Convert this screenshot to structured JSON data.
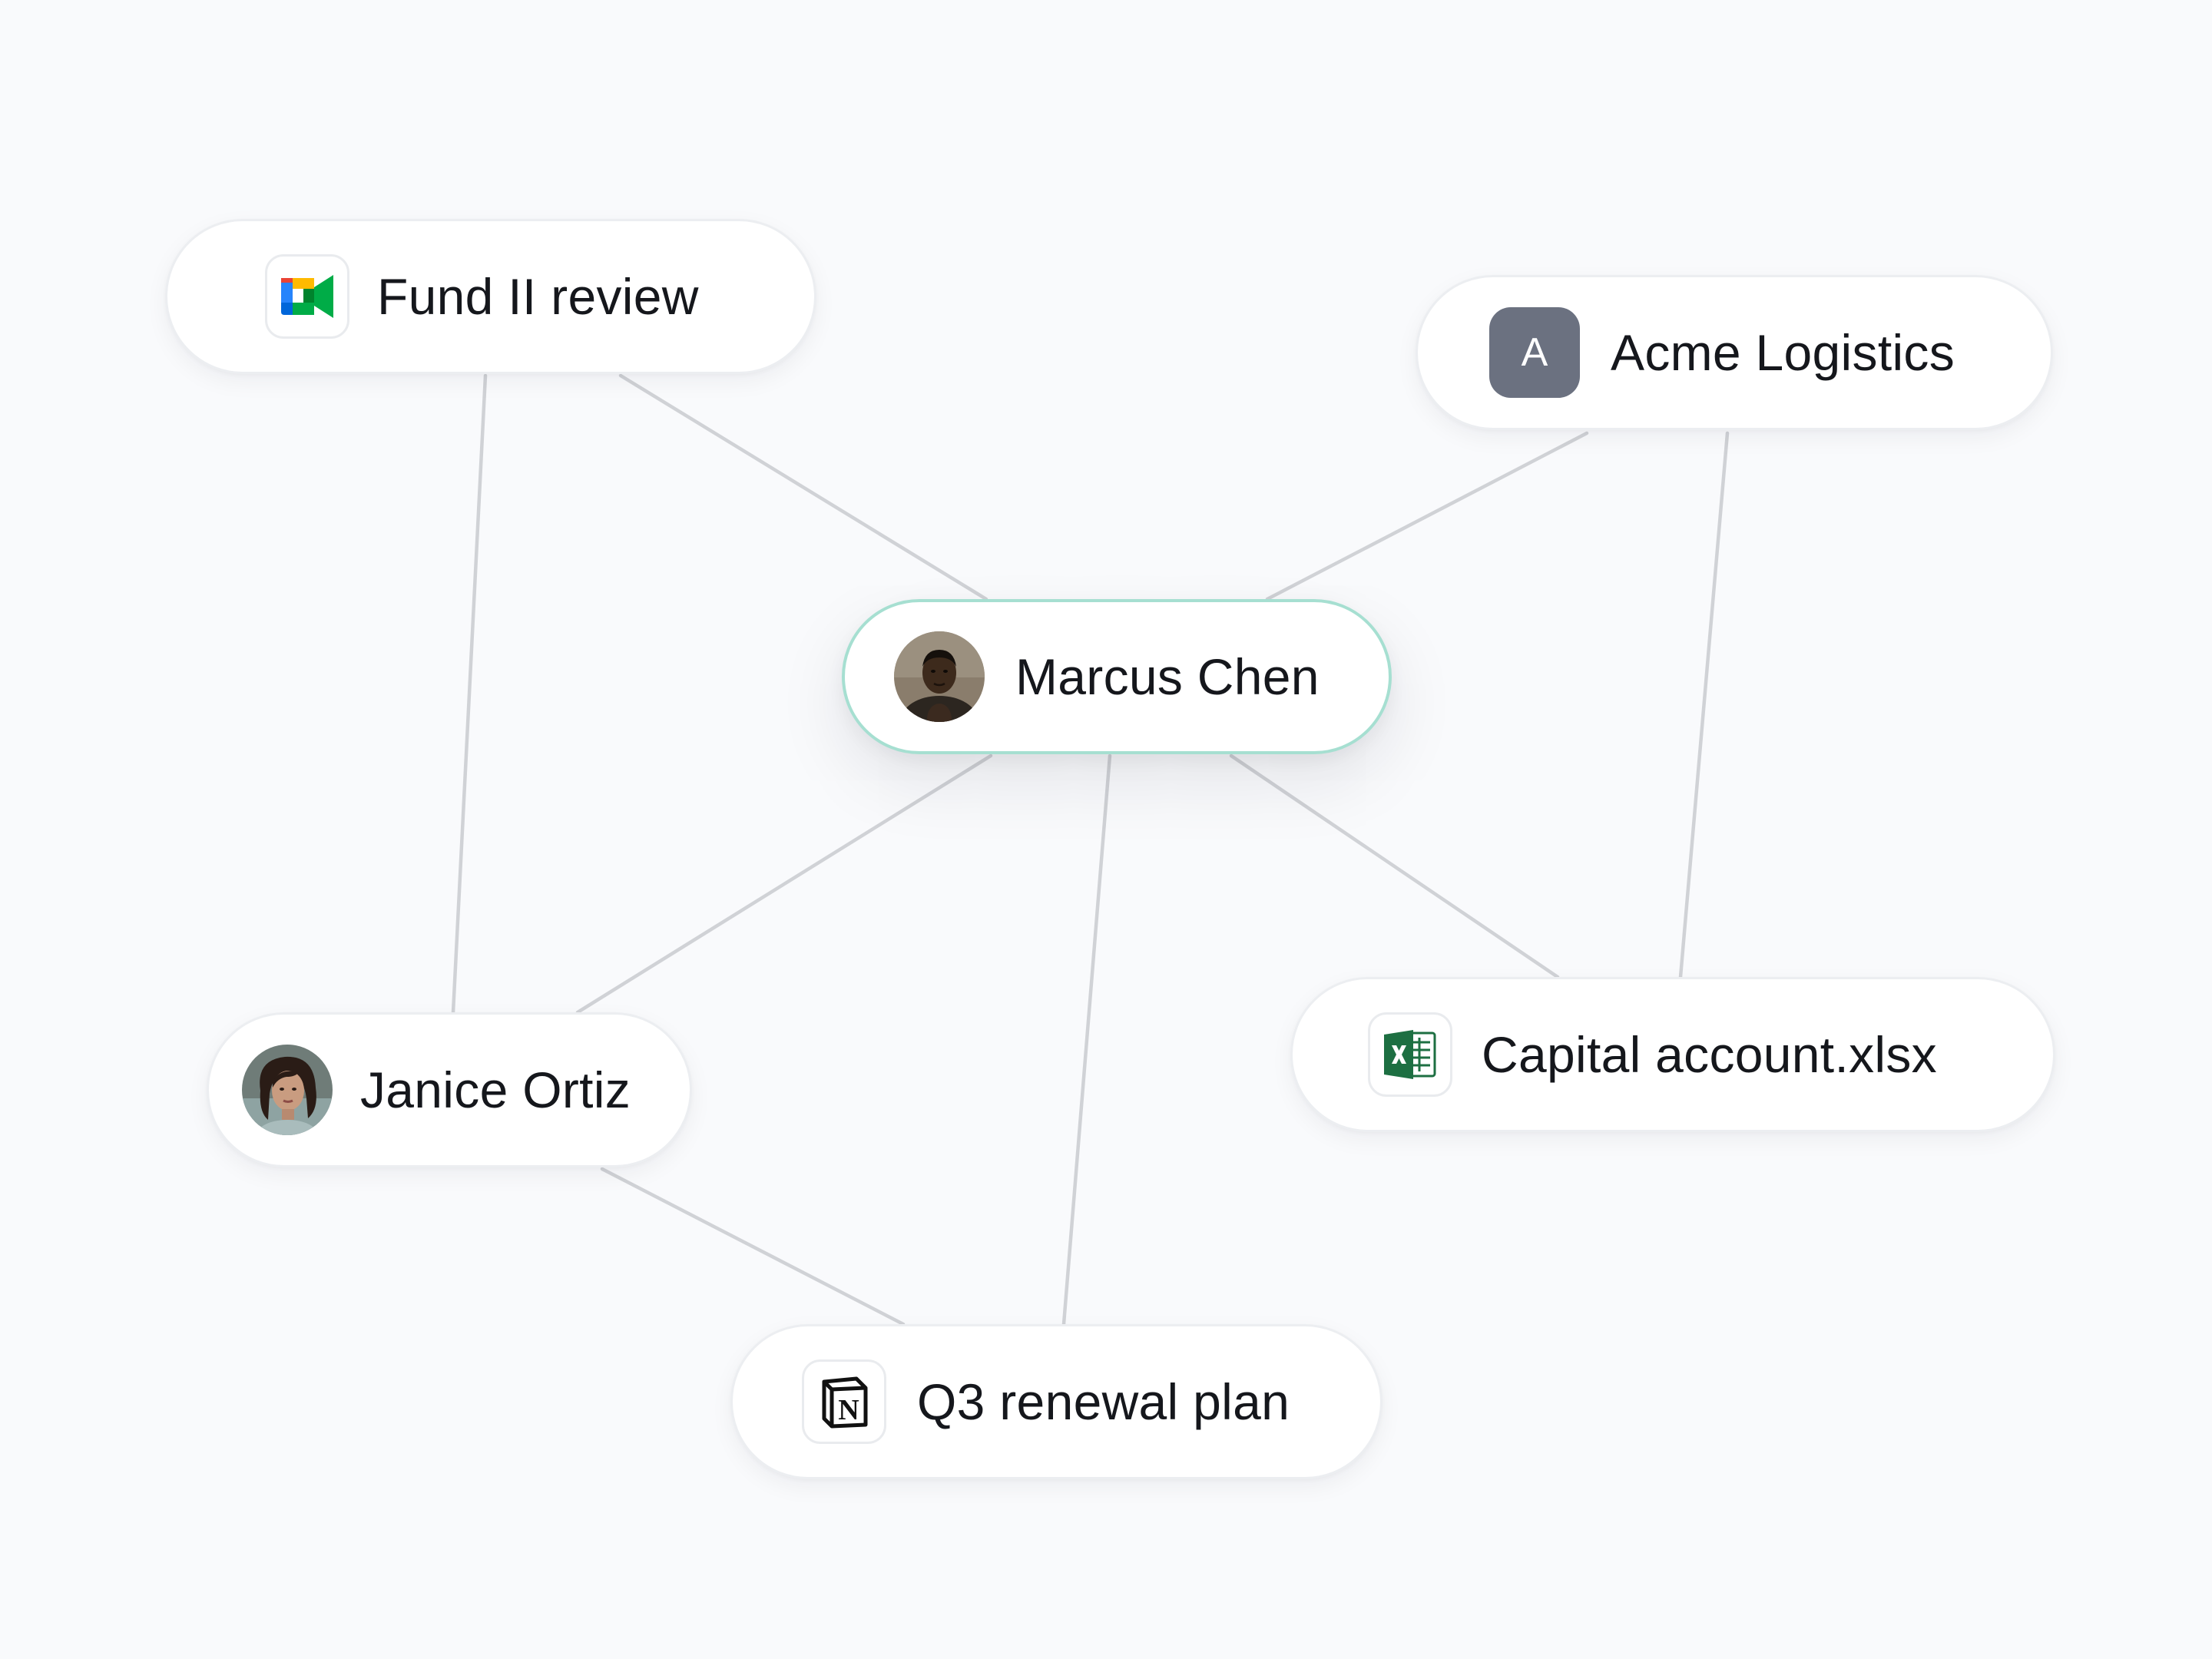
{
  "nodes": {
    "fund_review": {
      "label": "Fund II review",
      "icon": "google-meet-icon"
    },
    "acme": {
      "label": "Acme Logistics",
      "icon_letter": "A",
      "icon_color": "#6b7180"
    },
    "marcus": {
      "label": "Marcus Chen",
      "icon": "person-avatar",
      "accent": "#a6dfd1"
    },
    "janice": {
      "label": "Janice Ortiz",
      "icon": "person-avatar"
    },
    "capital": {
      "label": "Capital account.xlsx",
      "icon": "excel-icon",
      "icon_color": "#1d6f42"
    },
    "q3": {
      "label": "Q3 renewal plan",
      "icon": "notion-icon"
    }
  },
  "edges": [
    [
      "fund_review",
      "marcus"
    ],
    [
      "fund_review",
      "janice"
    ],
    [
      "acme",
      "marcus"
    ],
    [
      "acme",
      "capital"
    ],
    [
      "marcus",
      "janice"
    ],
    [
      "marcus",
      "q3"
    ],
    [
      "marcus",
      "capital"
    ],
    [
      "janice",
      "q3"
    ]
  ],
  "colors": {
    "background": "#f9fafc",
    "edge": "#d0d2d6",
    "node_border": "#eceef1"
  }
}
